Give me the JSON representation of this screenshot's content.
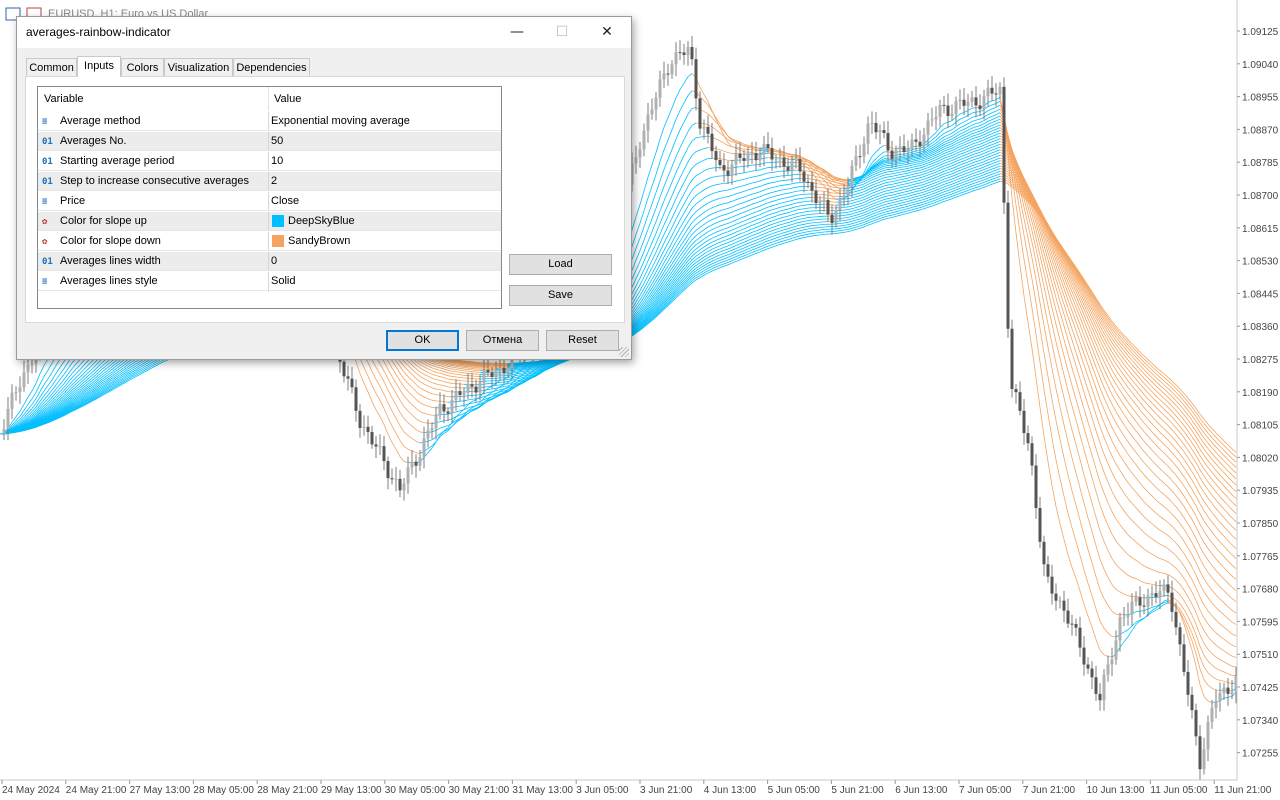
{
  "chart": {
    "window_title": "EURUSD, H1:  Euro vs US Dollar",
    "price_labels": [
      "1.09125",
      "1.09040",
      "1.08955",
      "1.08870",
      "1.08785",
      "1.08700",
      "1.08615",
      "1.08530",
      "1.08445",
      "1.08360",
      "1.08275",
      "1.08190",
      "1.08105",
      "1.08020",
      "1.07935",
      "1.07850",
      "1.07765",
      "1.07680",
      "1.07595",
      "1.07510",
      "1.07425",
      "1.07340",
      "1.07255"
    ],
    "time_labels": [
      "24 May 2024",
      "24 May 21:00",
      "27 May 13:00",
      "28 May 05:00",
      "28 May 21:00",
      "29 May 13:00",
      "30 May 05:00",
      "30 May 21:00",
      "31 May 13:00",
      "3 Jun 05:00",
      "3 Jun 21:00",
      "4 Jun 13:00",
      "5 Jun 05:00",
      "5 Jun 21:00",
      "6 Jun 13:00",
      "7 Jun 05:00",
      "7 Jun 21:00",
      "10 Jun 13:00",
      "11 Jun 05:00",
      "11 Jun 21:00"
    ],
    "colors": {
      "slope_up": "#00bfff",
      "slope_down": "#f4a460",
      "candle": "#7f7f7f"
    }
  },
  "dialog": {
    "title": "averages-rainbow-indicator",
    "controls": {
      "minimize": "—",
      "maximize": "☐",
      "close": "✕"
    },
    "tabs": [
      {
        "label": "Common",
        "active": false
      },
      {
        "label": "Inputs",
        "active": true
      },
      {
        "label": "Colors",
        "active": false
      },
      {
        "label": "Visualization",
        "active": false
      },
      {
        "label": "Dependencies",
        "active": false
      }
    ],
    "grid": {
      "col_variable": "Variable",
      "col_value": "Value",
      "rows": [
        {
          "icon": "enum-icon",
          "variable": "Average method",
          "value": "Exponential moving average"
        },
        {
          "icon": "int-icon",
          "variable": "Averages No.",
          "value": "50"
        },
        {
          "icon": "int-icon",
          "variable": "Starting average period",
          "value": "10"
        },
        {
          "icon": "int-icon",
          "variable": "Step to increase consecutive averages",
          "value": "2"
        },
        {
          "icon": "enum-icon",
          "variable": "Price",
          "value": "Close"
        },
        {
          "icon": "color-icon",
          "variable": "Color for slope up",
          "value": "DeepSkyBlue",
          "swatch": "#00bfff"
        },
        {
          "icon": "color-icon",
          "variable": "Color for slope down",
          "value": "SandyBrown",
          "swatch": "#f4a460"
        },
        {
          "icon": "int-icon",
          "variable": "Averages lines width",
          "value": "0"
        },
        {
          "icon": "enum-icon",
          "variable": "Averages lines style",
          "value": "Solid"
        }
      ]
    },
    "buttons": {
      "load": "Load",
      "save": "Save",
      "ok": "OK",
      "cancel": "Отмена",
      "reset": "Reset"
    }
  }
}
